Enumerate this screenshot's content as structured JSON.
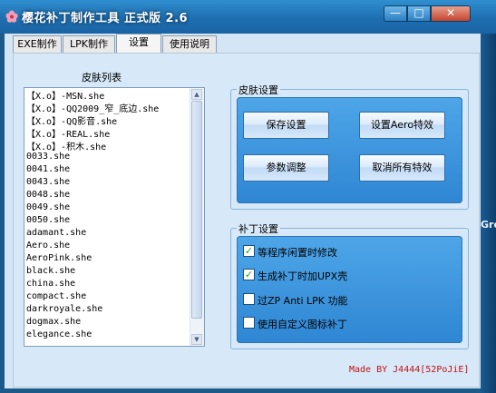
{
  "window": {
    "title": "樱花补丁制作工具 正式版 2.6",
    "minimize_label": "—",
    "maximize_label": "□",
    "close_label": "✕"
  },
  "tabs": [
    {
      "label": "EXE制作",
      "active": false
    },
    {
      "label": "LPK制作",
      "active": false
    },
    {
      "label": "设置",
      "active": true
    },
    {
      "label": "使用说明",
      "active": false
    }
  ],
  "skin_list": {
    "title": "皮肤列表",
    "items": [
      "【X.o】-MSN.she",
      "【X.o】-QQ2009_窄_底边.she",
      "【X.o】-QQ影音.she",
      "【X.o】-REAL.she",
      "【X.o】-积木.she",
      "0033.she",
      "0041.she",
      "0043.she",
      "0048.she",
      "0049.she",
      "0050.she",
      "adamant.she",
      "Aero.she",
      "AeroPink.she",
      "black.she",
      "china.she",
      "compact.she",
      "darkroyale.she",
      "dogmax.she",
      "elegance.she"
    ]
  },
  "skin_settings": {
    "legend": "皮肤设置",
    "save_label": "保存设置",
    "aero_label": "设置Aero特效",
    "param_label": "参数调整",
    "cancel_effects_label": "取消所有特效"
  },
  "patch_settings": {
    "legend": "补丁设置",
    "options": [
      {
        "label": "等程序闲置时修改",
        "checked": true
      },
      {
        "label": "生成补丁时加UPX壳",
        "checked": true
      },
      {
        "label": "过ZP Anti LPK 功能",
        "checked": false
      },
      {
        "label": "使用自定义图标补丁",
        "checked": false
      }
    ]
  },
  "credit": "Made BY J4444[52PoJiE]",
  "background_fragment": "Gre",
  "colors": {
    "title_bar": "#2f8fd0",
    "group_fill": "#4ea6e8",
    "credit_text": "#c21010",
    "check_mark": "#21a121"
  },
  "icons": {
    "app": "sakura-flower-icon",
    "check": "check-mark-icon"
  }
}
